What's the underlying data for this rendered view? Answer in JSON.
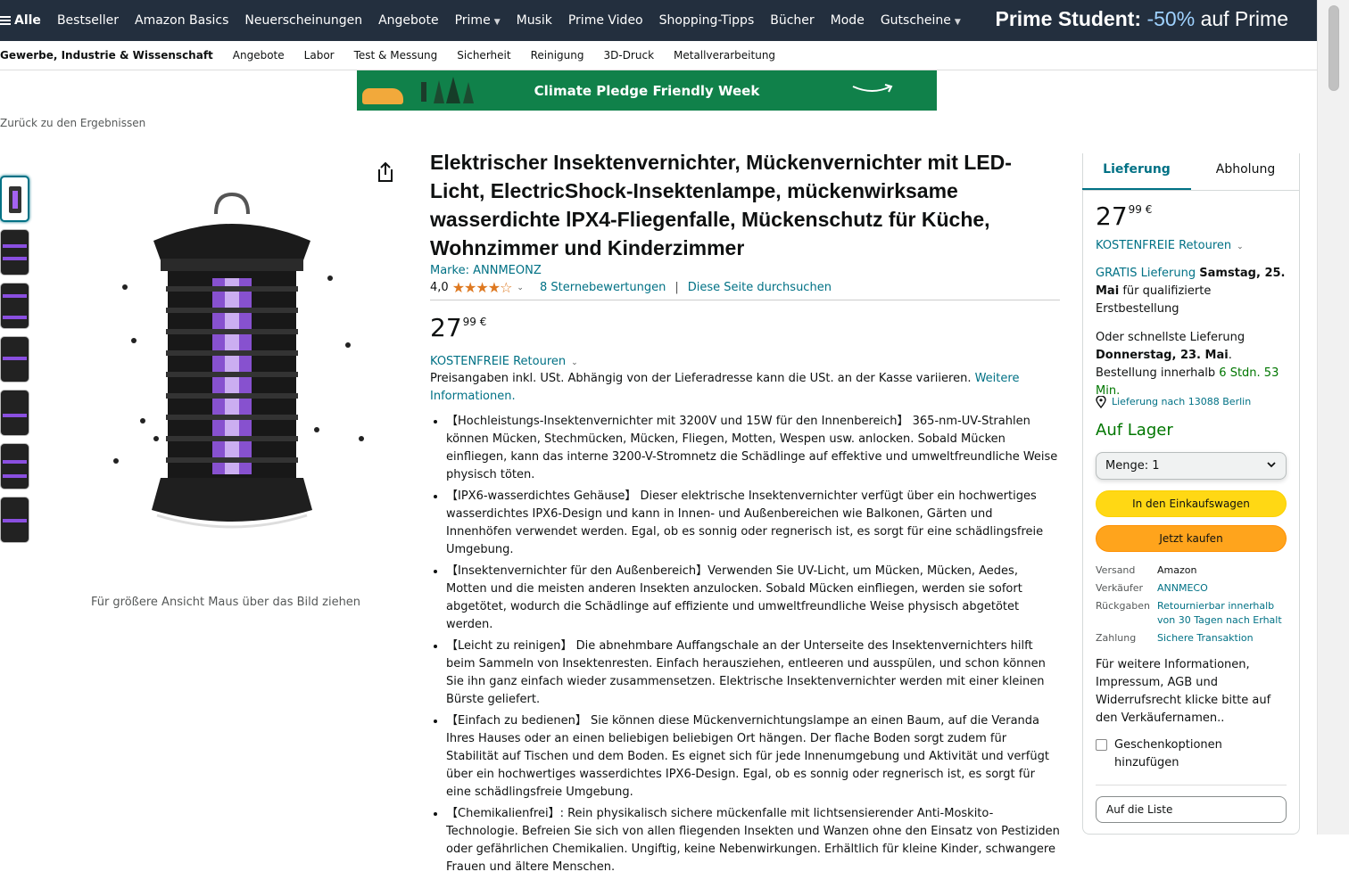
{
  "nav": {
    "all_label": "Alle",
    "items": [
      "Bestseller",
      "Amazon Basics",
      "Neuerscheinungen",
      "Angebote",
      "Prime",
      "Musik",
      "Prime Video",
      "Shopping-Tipps",
      "Bücher",
      "Mode",
      "Gutscheine"
    ],
    "promo": {
      "bold": "Prime Student:",
      "pct": "-50%",
      "rest": "auf Prime"
    }
  },
  "subnav": {
    "items": [
      "Gewerbe, Industrie & Wissenschaft",
      "Angebote",
      "Labor",
      "Test & Messung",
      "Sicherheit",
      "Reinigung",
      "3D-Druck",
      "Metallverarbeitung"
    ]
  },
  "banner": {
    "text": "Climate Pledge Friendly Week"
  },
  "back_link": "Zurück zu den Ergebnissen",
  "gallery": {
    "hover_hint": "Für größere Ansicht Maus über das Bild ziehen",
    "thumb_count": 7
  },
  "product": {
    "title": "Elektrischer Insektenvernichter, Mückenvernichter mit LED-Licht, ElectricShock-Insektenlampe, mückenwirksame wasserdichte lPX4-Fliegenfalle, Mückenschutz für Küche, Wohnzimmer und Kinderzimmer",
    "brand": "Marke: ANNMEONZ",
    "rating_value": "4,0",
    "rating_stars": 4.0,
    "rating_count": "8 Sternebewertungen",
    "search_page": "Diese Seite durchsuchen",
    "price_whole": "27",
    "price_fraction": "99 €",
    "returns": "KOSTENFREIE Retouren",
    "tax_text": "Preisangaben inkl. USt. Abhängig von der Lieferadresse kann die USt. an der Kasse variieren.",
    "tax_link": "Weitere Informationen.",
    "bullets": [
      "【Hochleistungs-Insektenvernichter mit 3200V und 15W für den Innenbereich】 365-nm-UV-Strahlen können Mücken, Stechmücken, Mücken, Fliegen, Motten, Wespen usw. anlocken. Sobald Mücken einfliegen, kann das interne 3200-V-Stromnetz die Schädlinge auf effektive und umweltfreundliche Weise physisch töten.",
      "【IPX6-wasserdichtes Gehäuse】 Dieser elektrische Insektenvernichter verfügt über ein hochwertiges wasserdichtes IPX6-Design und kann in Innen- und Außenbereichen wie Balkonen, Gärten und Innenhöfen verwendet werden. Egal, ob es sonnig oder regnerisch ist, es sorgt für eine schädlingsfreie Umgebung.",
      "【Insektenvernichter für den Außenbereich】Verwenden Sie UV-Licht, um Mücken, Mücken, Aedes, Motten und die meisten anderen Insekten anzulocken. Sobald Mücken einfliegen, werden sie sofort abgetötet, wodurch die Schädlinge auf effiziente und umweltfreundliche Weise physisch abgetötet werden.",
      "【Leicht zu reinigen】 Die abnehmbare Auffangschale an der Unterseite des Insektenvernichters hilft beim Sammeln von Insektenresten. Einfach herausziehen, entleeren und ausspülen, und schon können Sie ihn ganz einfach wieder zusammensetzen. Elektrische Insektenvernichter werden mit einer kleinen Bürste geliefert.",
      "【Einfach zu bedienen】 Sie können diese Mückenvernichtungslampe an einen Baum, auf die Veranda Ihres Hauses oder an einen beliebigen beliebigen Ort hängen. Der flache Boden sorgt zudem für Stabilität auf Tischen und dem Boden. Es eignet sich für jede Innenumgebung und Aktivität und verfügt über ein hochwertiges wasserdichtes IPX6-Design. Egal, ob es sonnig oder regnerisch ist, es sorgt für eine schädlingsfreie Umgebung.",
      "【Chemikalienfrei】: Rein physikalisch sichere mückenfalle mit lichtsensierender Anti-Moskito-Technologie. Befreien Sie sich von allen fliegenden Insekten und Wanzen ohne den Einsatz von Pestiziden oder gefährlichen Chemikalien. Ungiftig, keine Nebenwirkungen. Erhältlich für kleine Kinder, schwangere Frauen und ältere Menschen."
    ]
  },
  "buybox": {
    "tab_delivery": "Lieferung",
    "tab_pickup": "Abholung",
    "price_whole": "27",
    "price_fraction": "99 €",
    "returns": "KOSTENFREIE Retouren",
    "ship_link": "GRATIS Lieferung",
    "ship_date": "Samstag, 25. Mai",
    "ship_rest": "für qualifizierte Erstbestellung",
    "fast_prefix": "Oder schnellste Lieferung",
    "fast_date": "Donnerstag, 23. Mai",
    "fast_mid": ". Bestellung innerhalb",
    "fast_countdown": "6 Stdn. 53 Min.",
    "location": "Lieferung nach 13088 Berlin",
    "stock": "Auf Lager",
    "qty_label": "Menge:",
    "qty_value": "1",
    "add_to_cart": "In den Einkaufswagen",
    "buy_now": "Jetzt kaufen",
    "info": [
      {
        "k": "Versand",
        "v": "Amazon"
      },
      {
        "k": "Verkäufer",
        "v": "ANNMECO"
      },
      {
        "k": "Rückgaben",
        "v": "Retournierbar innerhalb von 30 Tagen nach Erhalt"
      },
      {
        "k": "Zahlung",
        "v": "Sichere Transaktion"
      }
    ],
    "more_info": "Für weitere Informationen, Impressum, AGB und Widerrufsrecht klicke bitte auf den Verkäufernamen..",
    "gift": "Geschenkoptionen hinzufügen",
    "add_to_list": "Auf die Liste"
  },
  "colors": {
    "nav_bg": "#232f3e",
    "link": "#007185",
    "stock": "#007600",
    "cart_button": "#ffd814",
    "buy_button": "#ffa41c",
    "stars": "#de7921",
    "banner_bg": "#10814a"
  },
  "icons": {
    "menu": "hamburger-icon",
    "share": "share-icon",
    "location": "location-pin-icon",
    "dropdown": "chevron-down-icon"
  }
}
